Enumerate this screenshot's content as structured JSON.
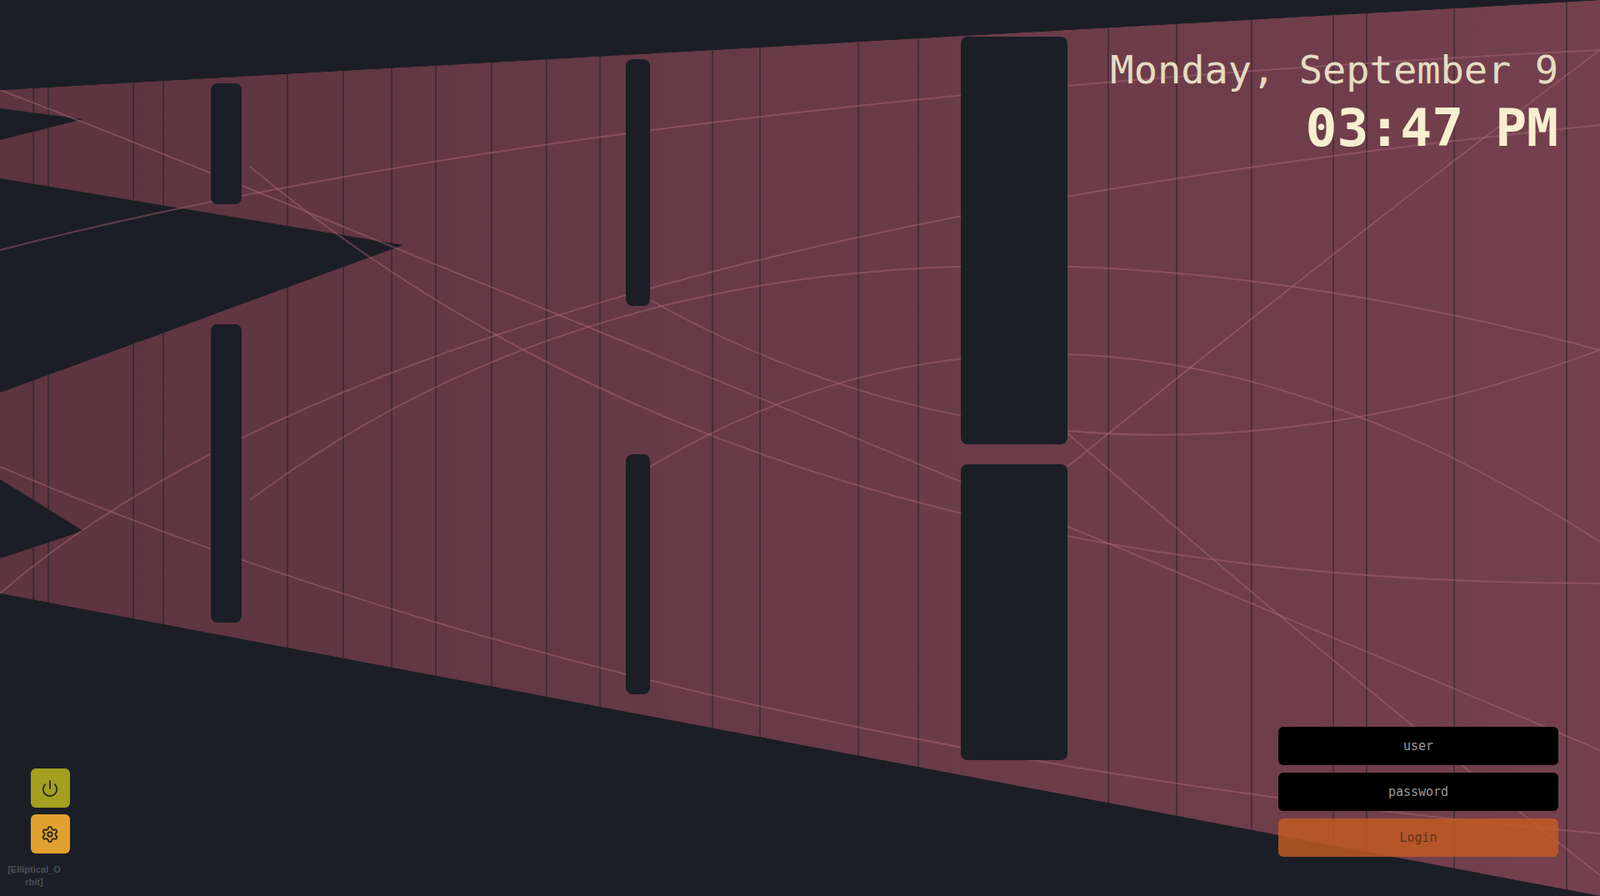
{
  "clock": {
    "date": "Monday, September 9",
    "time": "03:47 PM"
  },
  "login": {
    "fields": [
      {
        "placeholder": "user",
        "kind": "text"
      },
      {
        "placeholder": "password",
        "kind": "password"
      }
    ],
    "button": "Login"
  },
  "theme_label": "[Elliptical_Orbit]"
}
